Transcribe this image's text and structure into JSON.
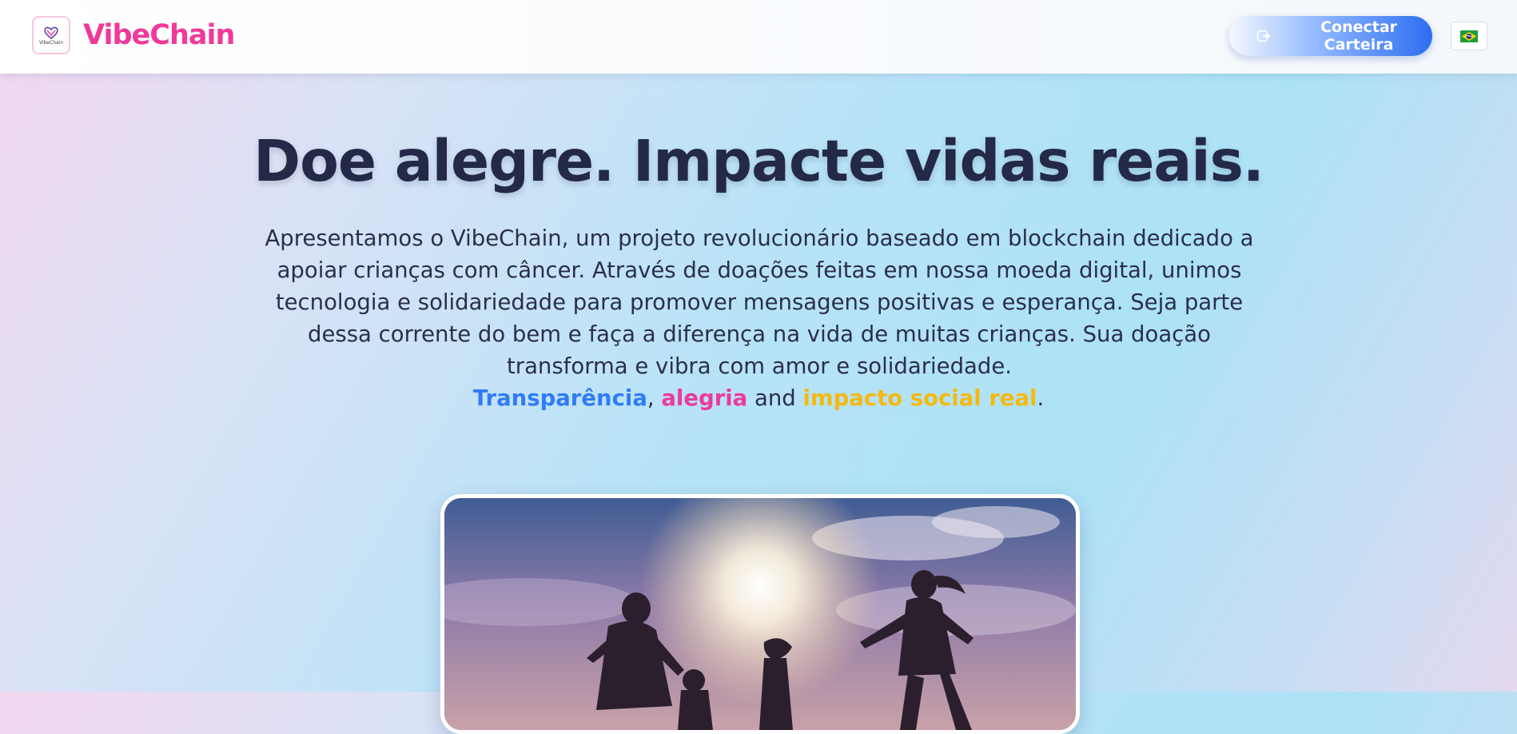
{
  "header": {
    "logo_icon": "vibechain-heart-logo-icon",
    "logo_text": "VibeChain",
    "brand_name": "VibeChain",
    "brand_color": "#f0399a",
    "wallet_button": {
      "label": "Conectar Carteira",
      "icon": "wallet-login-icon",
      "accent": "#2d6ef0"
    },
    "language_icon": "brazil-flag-icon"
  },
  "hero": {
    "title": "Doe alegre. Impacte vidas reais.",
    "description": "Apresentamos o VibeChain, um projeto revolucionário baseado em blockchain dedicado a apoiar crianças com câncer. Através de doações feitas em nossa moeda digital, unimos tecnologia e solidariedade para promover mensagens positivas e esperança. Seja parte dessa corrente do bem e faça a diferença na vida de muitas crianças. Sua doação transforma e vibra com amor e solidariedade.",
    "tagline": {
      "word1": "Transparência",
      "sep1": ", ",
      "word2": "alegria",
      "sep2": " and ",
      "word3": "impacto social real",
      "end": ".",
      "colors": {
        "word1": "#2f7cf6",
        "word2": "#ee3a9a",
        "word3": "#f5b90f"
      }
    },
    "image": "family-silhouettes-sunset-photo"
  }
}
